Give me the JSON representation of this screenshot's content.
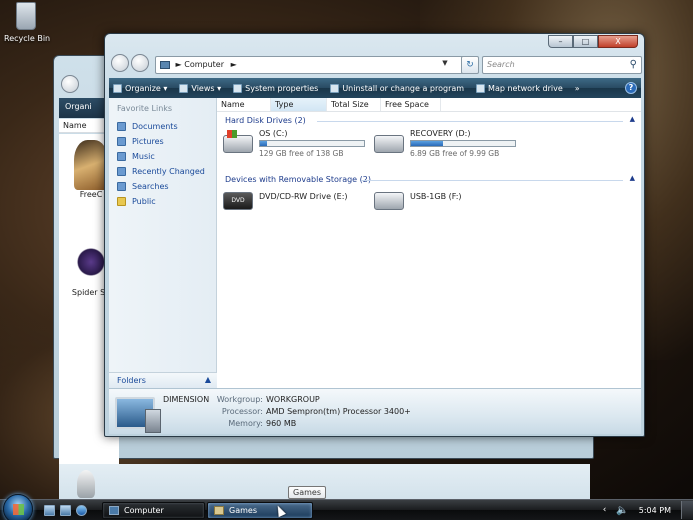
{
  "desktop": {
    "recycle_bin_label": "Recycle Bin"
  },
  "games_window": {
    "toolbar_label": "Organi",
    "column_name": "Name",
    "items": [
      {
        "label": "FreeC",
        "icon": "chess-piece-icon"
      },
      {
        "label": "Spider So",
        "icon": "spider-icon"
      }
    ]
  },
  "computer_window": {
    "caption_buttons": {
      "minimize": "–",
      "maximize": "□",
      "close": "X"
    },
    "address": {
      "location": "Computer",
      "separator": "►",
      "dropdown": "▼"
    },
    "search": {
      "placeholder": "Search",
      "icon": "magnifier-icon"
    },
    "refresh_glyph": "↻",
    "command_bar": {
      "organize": "Organize",
      "views": "Views",
      "system_properties": "System properties",
      "uninstall": "Uninstall or change a program",
      "map_drive": "Map network drive",
      "more": "»",
      "help": "?"
    },
    "nav_pane": {
      "title": "Favorite Links",
      "links": [
        "Documents",
        "Pictures",
        "Music",
        "Recently Changed",
        "Searches",
        "Public"
      ],
      "folders_label": "Folders",
      "folders_chevron": "▲"
    },
    "columns": [
      "Name",
      "Type",
      "Total Size",
      "Free Space"
    ],
    "groups": [
      {
        "title": "Hard Disk Drives (2)",
        "drives": [
          {
            "name": "OS (C:)",
            "free_text": "129 GB free of 138 GB",
            "used_fraction": 0.065
          },
          {
            "name": "RECOVERY (D:)",
            "free_text": "6.89 GB free of 9.99 GB",
            "used_fraction": 0.31
          }
        ]
      },
      {
        "title": "Devices with Removable Storage (2)",
        "drives": [
          {
            "name": "DVD/CD-RW Drive (E:)",
            "icon_text": "DVD"
          },
          {
            "name": "USB-1GB (F:)"
          }
        ]
      }
    ],
    "group_chevron": "▲",
    "details": {
      "computer_name": "DIMENSION",
      "rows": [
        {
          "label": "Workgroup:",
          "value": "WORKGROUP"
        },
        {
          "label": "Processor:",
          "value": "AMD Sempron(tm) Processor 3400+"
        },
        {
          "label": "Memory:",
          "value": "960 MB"
        }
      ]
    }
  },
  "taskbar": {
    "buttons": [
      {
        "label": "Computer"
      },
      {
        "label": "Games"
      }
    ],
    "tooltip": "Games",
    "tray_chevron": "‹",
    "volume_glyph": "🔈",
    "clock": "5:04 PM"
  }
}
